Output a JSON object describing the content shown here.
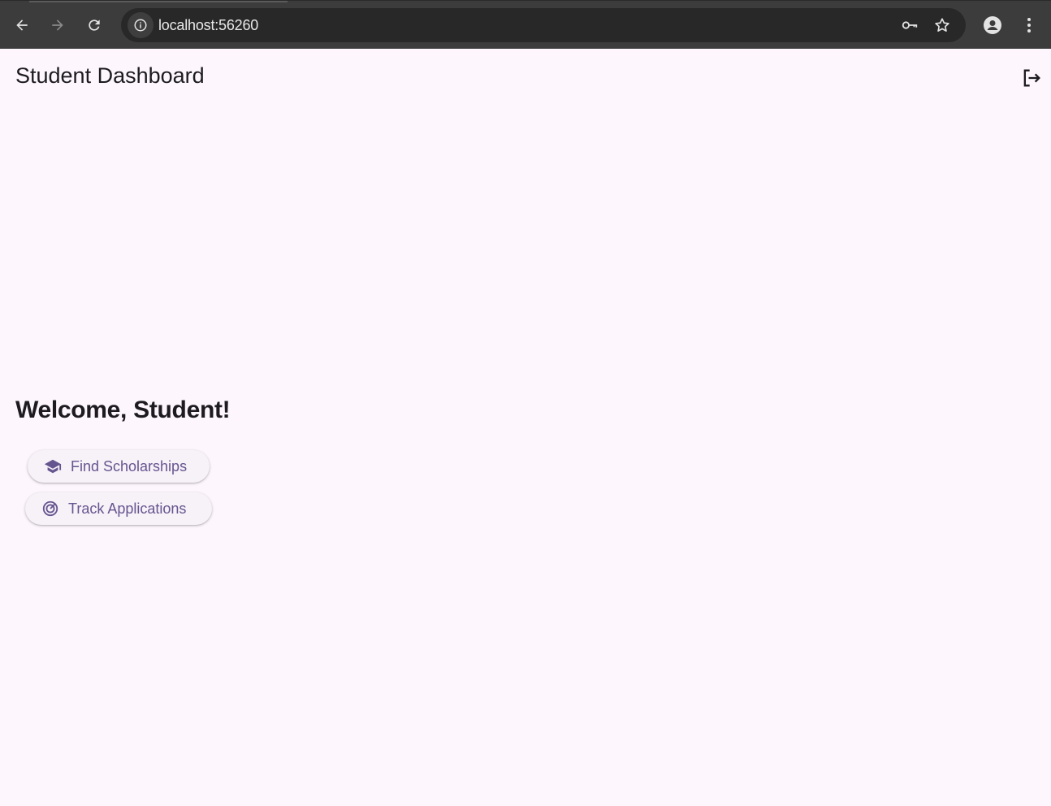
{
  "browser": {
    "url": "localhost:56260",
    "icons": {
      "back": "back-arrow-icon",
      "forward": "forward-arrow-icon",
      "reload": "reload-icon",
      "site_info": "info-icon",
      "password": "key-icon",
      "bookmark": "star-icon",
      "profile": "profile-icon",
      "menu": "more-vert-icon"
    }
  },
  "app": {
    "title": "Student Dashboard",
    "logout_icon": "logout-icon",
    "welcome": "Welcome, Student!",
    "buttons": [
      {
        "label": "Find Scholarships",
        "icon": "school-icon"
      },
      {
        "label": "Track Applications",
        "icon": "track-changes-icon"
      }
    ]
  },
  "colors": {
    "background": "#fdf7fd",
    "accent": "#65558f",
    "button_bg": "#f7f1f8",
    "text": "#1d1b20",
    "chrome_bg": "#3c3c3c",
    "omnibox_bg": "#282828"
  }
}
